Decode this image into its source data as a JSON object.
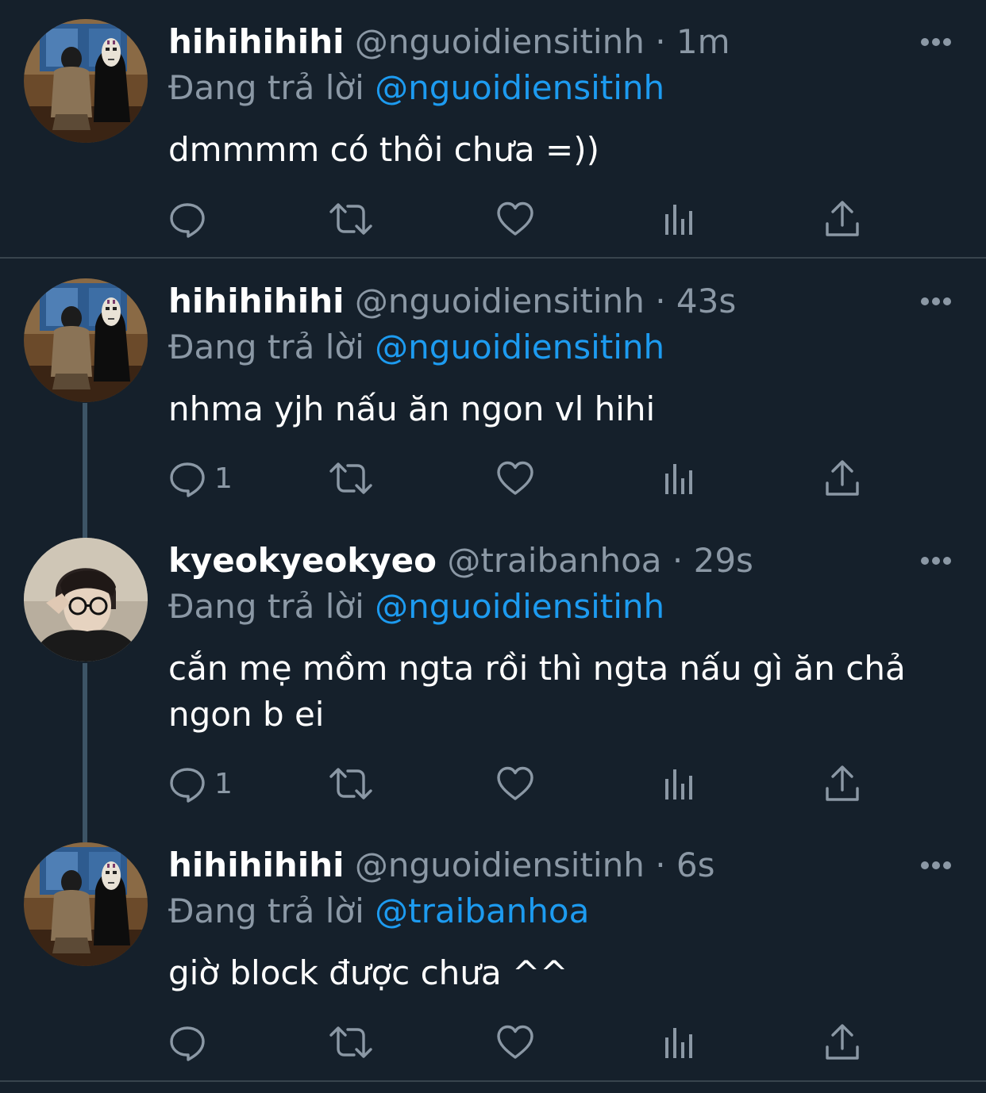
{
  "colors": {
    "background": "#15202b",
    "muted": "#8b98a5",
    "mention": "#1d9bf0",
    "divider": "#38444d"
  },
  "icons": [
    "reply-icon",
    "retweet-icon",
    "like-icon",
    "analytics-icon",
    "share-icon",
    "more-icon"
  ],
  "tweets": [
    {
      "display_name": "hihihihihi",
      "handle": "@nguoidiensitinh",
      "separator": "·",
      "time": "1m",
      "reply_prefix": "Đang trả lời",
      "reply_to": "@nguoidiensitinh",
      "text": "dmmmm có thôi chưa =))",
      "reply_count": ""
    },
    {
      "display_name": "hihihihihi",
      "handle": "@nguoidiensitinh",
      "separator": "·",
      "time": "43s",
      "reply_prefix": "Đang trả lời",
      "reply_to": "@nguoidiensitinh",
      "text": "nhma yjh nấu ăn ngon vl hihi",
      "reply_count": "1"
    },
    {
      "display_name": "kyeokyeokyeo",
      "handle": "@traibanhoa",
      "separator": "·",
      "time": "29s",
      "reply_prefix": "Đang trả lời",
      "reply_to": "@nguoidiensitinh",
      "text_line1": "cắn mẹ mồm ngta rồi thì ngta nấu gì ăn chả",
      "text_line2": "ngon b ei",
      "reply_count": "1"
    },
    {
      "display_name": "hihihihihi",
      "handle": "@nguoidiensitinh",
      "separator": "·",
      "time": "6s",
      "reply_prefix": "Đang trả lời",
      "reply_to": "@traibanhoa",
      "text": "giờ block được chưa ^^",
      "reply_count": ""
    }
  ]
}
